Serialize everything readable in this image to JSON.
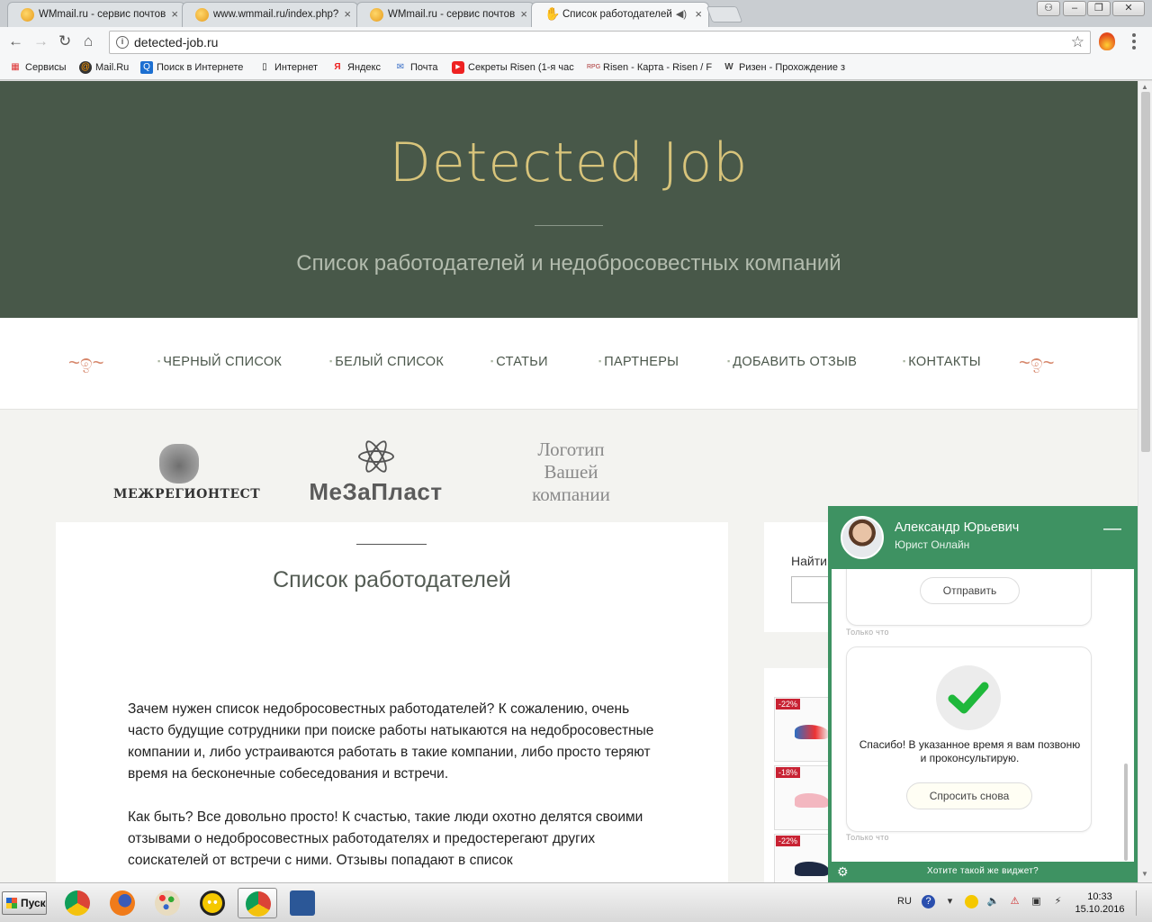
{
  "browser": {
    "tabs": [
      {
        "title": "WMmail.ru - сервис почтов"
      },
      {
        "title": "www.wmmail.ru/index.php?"
      },
      {
        "title": "WMmail.ru - сервис почтов"
      },
      {
        "title": "Список работодателей"
      }
    ],
    "url": "detected-job.ru",
    "bookmarks": [
      {
        "label": "Сервисы",
        "icon": "apps-icon"
      },
      {
        "label": "Mail.Ru",
        "icon": "mailru-icon"
      },
      {
        "label": "Поиск в Интернете",
        "icon": "search-icon"
      },
      {
        "label": "Интернет",
        "icon": "page-icon"
      },
      {
        "label": "Яндекс",
        "icon": "yandex-icon"
      },
      {
        "label": "Почта",
        "icon": "mail-icon"
      },
      {
        "label": "Секреты Risen (1-я час",
        "icon": "youtube-icon"
      },
      {
        "label": "Risen - Карта - Risen / F",
        "icon": "rpg-icon"
      },
      {
        "label": "Ризен - Прохождение з",
        "icon": "w-icon"
      }
    ]
  },
  "site": {
    "title": "Detected Job",
    "subtitle": "Список работодателей и недобросовестных компаний",
    "nav": [
      "ЧЕРНЫЙ СПИСОК",
      "БЕЛЫЙ СПИСОК",
      "СТАТЬИ",
      "ПАРТНЕРЫ",
      "ДОБАВИТЬ ОТЗЫВ",
      "КОНТАКТЫ"
    ],
    "partners": {
      "logo1": "МЕЖРЕГИОНТЕСТ",
      "logo2": "МеЗаПласт",
      "logo3": [
        "Логотип",
        "Вашей",
        "компании"
      ]
    },
    "content": {
      "title": "Список работодателей",
      "paragraphs": [
        "Зачем нужен список недобросовестных работодателей? К сожалению, очень часто будущие сотрудники при поиске работы натыкаются на недобросовестные компании и, либо устраиваются работать в такие компании, либо просто теряют время на бесконечные собеседования и встречи.",
        "Как быть? Все довольно просто! К счастью, такие люди охотно делятся своими отзывами о недобросовестных работодателях и предостерегают других соискателей от встречи с ними. Отзывы попадают в список"
      ]
    },
    "sidebar": {
      "search_label": "Найти",
      "ads": [
        "-22%",
        "-18%",
        "-22%"
      ]
    }
  },
  "chat": {
    "agent_name": "Александр Юрьевич",
    "agent_role": "Юрист Онлайн",
    "send_button": "Отправить",
    "timestamp1": "Только что",
    "thanks": "Спасибо! В указанное время я вам позвоню и проконсультирую.",
    "ask_again_button": "Спросить снова",
    "timestamp2": "Только что",
    "promo": "Хотите такой же виджет?"
  },
  "taskbar": {
    "start": "Пуск",
    "lang": "RU",
    "time": "10:33",
    "date": "15.10.2016"
  },
  "colors": {
    "hero_bg": "#485849",
    "title_gold": "#d8c47b",
    "chat_green": "#3e9262",
    "flourish": "#d6866a"
  }
}
